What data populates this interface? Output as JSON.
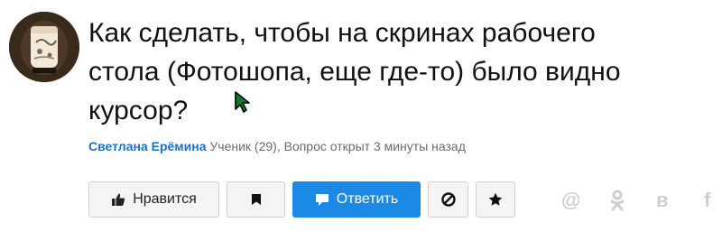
{
  "question": {
    "title": "Как сделать, чтобы на скринах рабочего стола (Фотошопа, еще где-то) было видно курсор?",
    "author": "Светлана Ерёмина",
    "details": "Ученик (29), Вопрос открыт 3 минуты назад"
  },
  "actions": {
    "like_label": "Нравится",
    "answer_label": "Ответить"
  },
  "share": {
    "mail": "@",
    "ok": "ок",
    "vk": "в",
    "fb": "f"
  },
  "colors": {
    "accent": "#1a8ae6",
    "author_link": "#1a73c7"
  },
  "icons": {
    "like": "thumbs-up-icon",
    "flag": "flag-icon",
    "answer": "speech-bubble-icon",
    "block": "block-icon",
    "star": "star-icon",
    "cursor": "mouse-cursor-icon"
  }
}
